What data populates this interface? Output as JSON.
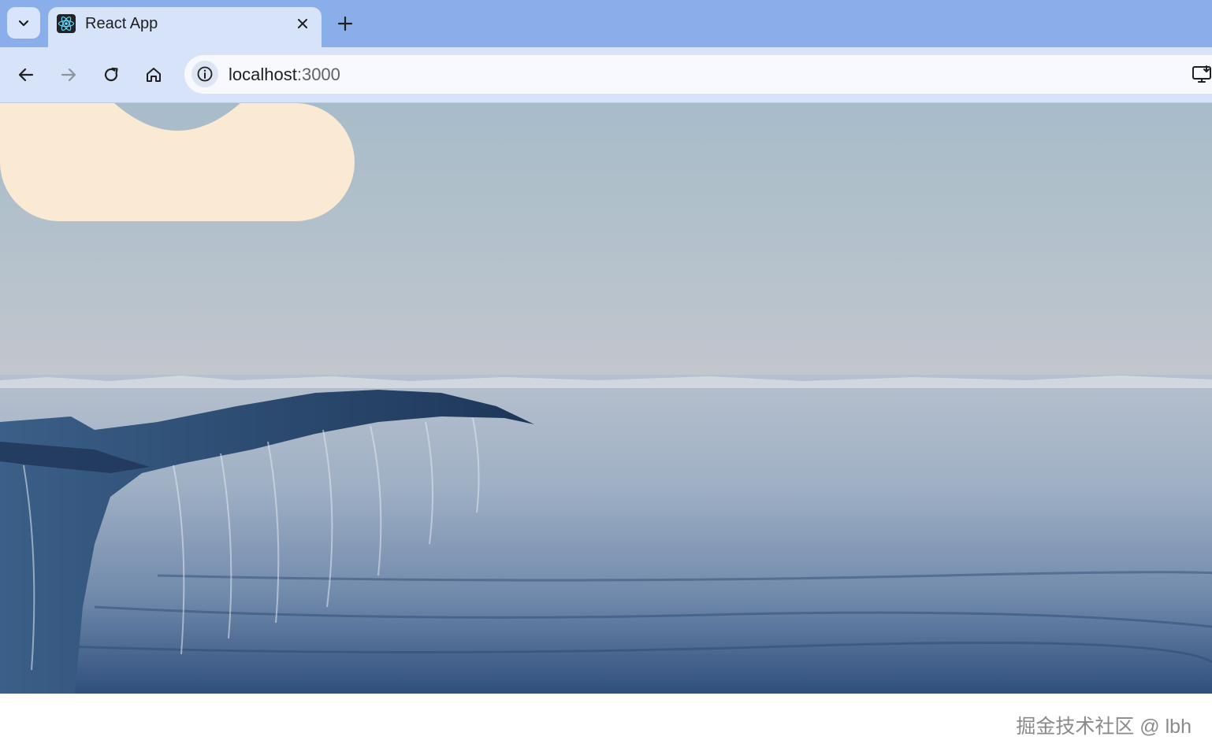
{
  "browser": {
    "tab": {
      "title": "React App"
    },
    "address_bar": {
      "host": "localhost",
      "port": ":3000"
    }
  },
  "icons": {
    "tab_search": "chevron-down-icon",
    "favicon": "react-logo-icon",
    "close": "close-icon",
    "new_tab": "plus-icon",
    "back": "arrow-left-icon",
    "forward": "arrow-right-icon",
    "reload": "reload-icon",
    "home": "home-icon",
    "site_info": "info-icon",
    "install": "install-app-icon"
  },
  "content": {
    "background_description": "whale tail above calm sea",
    "shape_color": "#fbead3"
  },
  "footer": {
    "watermark": "掘金技术社区 @ lbh"
  },
  "colors": {
    "tabstrip": "#8aaee9",
    "toolbar": "#d6e3f9",
    "omnibox": "#f7f9fe"
  }
}
